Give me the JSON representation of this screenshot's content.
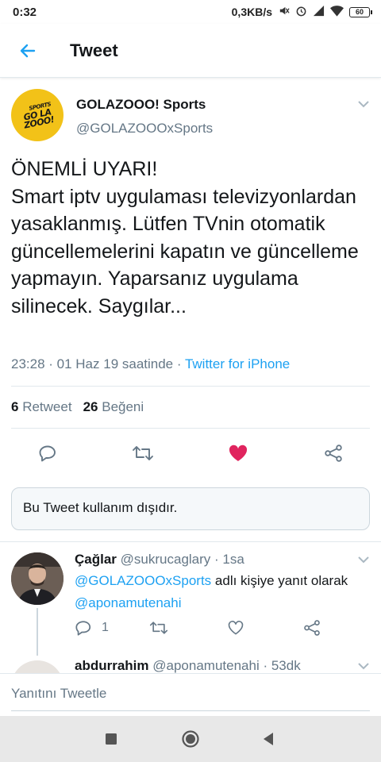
{
  "status_bar": {
    "time": "0:32",
    "network_speed": "0,3KB/s",
    "battery": "60",
    "icons": [
      "mute-icon",
      "alarm-icon",
      "signal-icon",
      "wifi-icon",
      "battery-icon"
    ]
  },
  "header": {
    "title": "Tweet",
    "back_icon": "back-arrow-icon"
  },
  "tweet": {
    "author_name": "GOLAZOOO! Sports",
    "author_handle": "@GOLAZOOOxSports",
    "avatar_logo_text": "SPORTS GOLAZOOO!",
    "text": "ÖNEMLİ UYARI!\nSmart iptv uygulaması televizyonlardan yasaklanmış. Lütfen TVnin otomatik güncellemelerini kapatın ve güncelleme yapmayın. Yaparsanız uygulama silinecek. Saygılar...",
    "timestamp": "23:28 · 01 Haz 19 saatinde · ",
    "source": "Twitter for iPhone",
    "retweet_count": "6",
    "retweet_label": "Retweet",
    "like_count": "26",
    "like_label": "Beğeni",
    "liked": true,
    "colors": {
      "like": "#e0245e",
      "accent": "#1da1f2",
      "muted": "#657786"
    }
  },
  "unavailable_notice": "Bu Tweet kullanım dışıdır.",
  "replies": [
    {
      "name": "Çağlar",
      "handle": "@sukrucaglary",
      "time": "1sa",
      "reply_to_handle": "@GOLAZOOOxSports",
      "reply_to_text": "adlı kişiye yanıt olarak",
      "mention": "@aponamutenahi",
      "reply_count": "1"
    },
    {
      "name": "abdurrahim",
      "handle": "@aponamutenahi",
      "time": "53dk"
    }
  ],
  "compose": {
    "placeholder": "Yanıtını Tweetle"
  },
  "navbar": {
    "icons": [
      "recents-icon",
      "home-icon",
      "back-triangle-icon"
    ]
  }
}
